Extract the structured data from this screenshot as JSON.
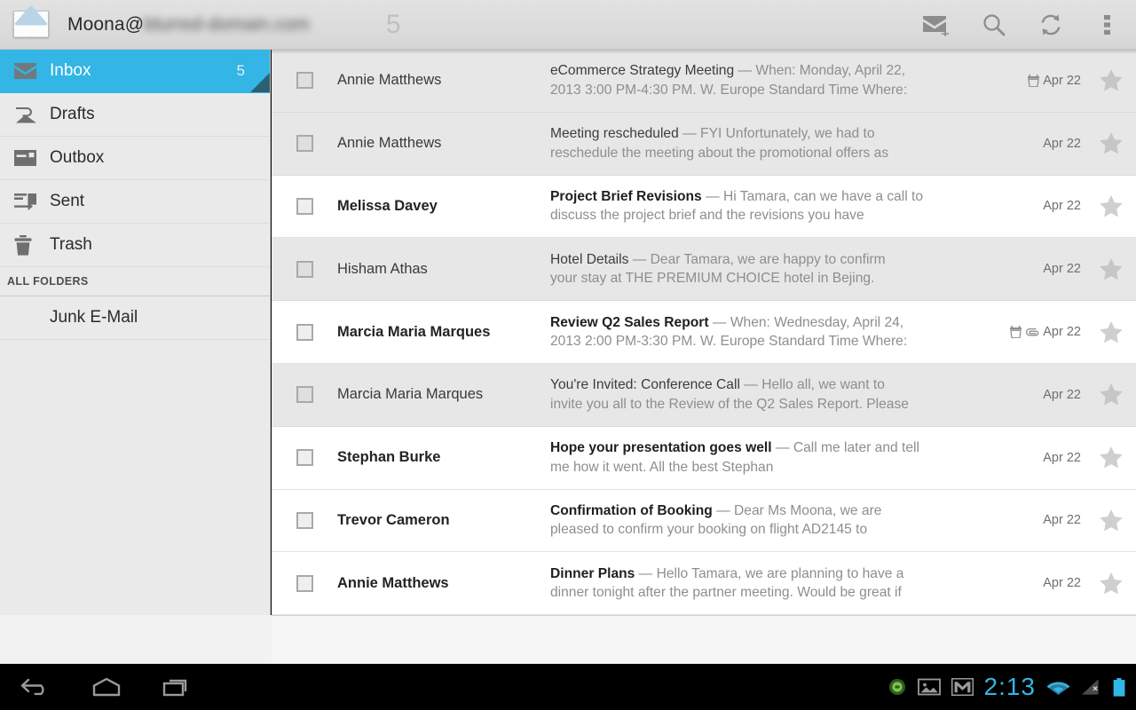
{
  "actionbar": {
    "app_icon": "envelope-icon",
    "account_user": "Moona@",
    "account_domain_redacted": "blurred-domain.com",
    "unread_badge": "5",
    "actions": [
      {
        "name": "compose",
        "icon": "compose-mail-icon",
        "label": "Compose"
      },
      {
        "name": "search",
        "icon": "search-icon",
        "label": "Search"
      },
      {
        "name": "refresh",
        "icon": "refresh-icon",
        "label": "Refresh"
      },
      {
        "name": "more",
        "icon": "overflow-menu-icon",
        "label": "More options"
      }
    ]
  },
  "sidebar": {
    "section_label": "ALL FOLDERS",
    "items": [
      {
        "label": "Inbox",
        "icon": "inbox-envelope-icon",
        "count": "5",
        "selected": true
      },
      {
        "label": "Drafts",
        "icon": "drafts-icon",
        "count": "",
        "selected": false
      },
      {
        "label": "Outbox",
        "icon": "outbox-icon",
        "count": "",
        "selected": false
      },
      {
        "label": "Sent",
        "icon": "sent-icon",
        "count": "",
        "selected": false
      },
      {
        "label": "Trash",
        "icon": "trash-icon",
        "count": "",
        "selected": false
      }
    ],
    "all_folders": [
      {
        "label": "Junk E-Mail",
        "count": ""
      }
    ]
  },
  "messages": [
    {
      "sender": "Annie Matthews",
      "subject": "eCommerce Strategy Meeting",
      "separator": " — ",
      "preview_line1": "When: Monday, April 22,",
      "preview_line2": "2013 3:00 PM-4:30 PM. W. Europe Standard Time Where:",
      "date": "Apr 22",
      "unread": false,
      "has_calendar": true,
      "has_attachment": false,
      "starred": false
    },
    {
      "sender": "Annie Matthews",
      "subject": "Meeting rescheduled",
      "separator": " — ",
      "preview_line1": "FYI Unfortunately, we had to",
      "preview_line2": "reschedule the meeting about the promotional offers as",
      "date": "Apr 22",
      "unread": false,
      "has_calendar": false,
      "has_attachment": false,
      "starred": false
    },
    {
      "sender": "Melissa Davey",
      "subject": "Project Brief Revisions",
      "separator": " — ",
      "preview_line1": "Hi Tamara, can we have a call to",
      "preview_line2": "discuss the project brief and the revisions you have",
      "date": "Apr 22",
      "unread": true,
      "has_calendar": false,
      "has_attachment": false,
      "starred": false
    },
    {
      "sender": "Hisham Athas",
      "subject": "Hotel Details",
      "separator": " — ",
      "preview_line1": "Dear Tamara, we are happy to confirm",
      "preview_line2": "your stay at THE PREMIUM CHOICE hotel in Bejing.",
      "date": "Apr 22",
      "unread": false,
      "has_calendar": false,
      "has_attachment": false,
      "starred": false
    },
    {
      "sender": "Marcia Maria Marques",
      "subject": "Review Q2 Sales Report",
      "separator": " — ",
      "preview_line1": "When: Wednesday, April 24,",
      "preview_line2": "2013 2:00 PM-3:30 PM. W. Europe Standard Time Where:",
      "date": "Apr 22",
      "unread": true,
      "has_calendar": true,
      "has_attachment": true,
      "starred": false
    },
    {
      "sender": "Marcia Maria Marques",
      "subject": "You're Invited: Conference Call",
      "separator": " — ",
      "preview_line1": "Hello all, we want to",
      "preview_line2": "invite you all to the Review of the Q2 Sales Report. Please",
      "date": "Apr 22",
      "unread": false,
      "has_calendar": false,
      "has_attachment": false,
      "starred": false
    },
    {
      "sender": "Stephan Burke",
      "subject": "Hope your presentation goes well",
      "separator": " — ",
      "preview_line1": "Call me later and tell",
      "preview_line2": "me how it went. All the best Stephan",
      "date": "Apr 22",
      "unread": true,
      "has_calendar": false,
      "has_attachment": false,
      "starred": false
    },
    {
      "sender": "Trevor Cameron",
      "subject": "Confirmation of Booking",
      "separator": " — ",
      "preview_line1": "Dear Ms Moona, we are",
      "preview_line2": "pleased to confirm your booking on flight AD2145 to",
      "date": "Apr 22",
      "unread": true,
      "has_calendar": false,
      "has_attachment": false,
      "starred": false
    },
    {
      "sender": "Annie Matthews",
      "subject": "Dinner Plans",
      "separator": " — ",
      "preview_line1": "Hello Tamara, we are planning to have a",
      "preview_line2": "dinner tonight after the partner meeting. Would be great if",
      "date": "Apr 22",
      "unread": true,
      "has_calendar": false,
      "has_attachment": false,
      "starred": false
    }
  ],
  "navbar": {
    "buttons": [
      {
        "name": "back",
        "icon": "back-arrow-icon"
      },
      {
        "name": "home",
        "icon": "home-icon"
      },
      {
        "name": "recents",
        "icon": "recent-apps-icon"
      }
    ],
    "status": {
      "icons": [
        "sync-status-icon",
        "screenshot-image-icon",
        "gmail-icon"
      ],
      "clock": "2:13",
      "right_icons": [
        "wifi-icon",
        "cellular-signal-off-icon",
        "battery-icon"
      ]
    }
  },
  "colors": {
    "accent_blue": "#33b5e5",
    "actionbar_bg": "#dcdcdc",
    "sidebar_bg": "#eaeaea",
    "row_read_bg": "#e7e7e7",
    "row_unread_bg": "#ffffff",
    "navbar_bg": "#000000",
    "clock_color": "#33b5e5"
  }
}
